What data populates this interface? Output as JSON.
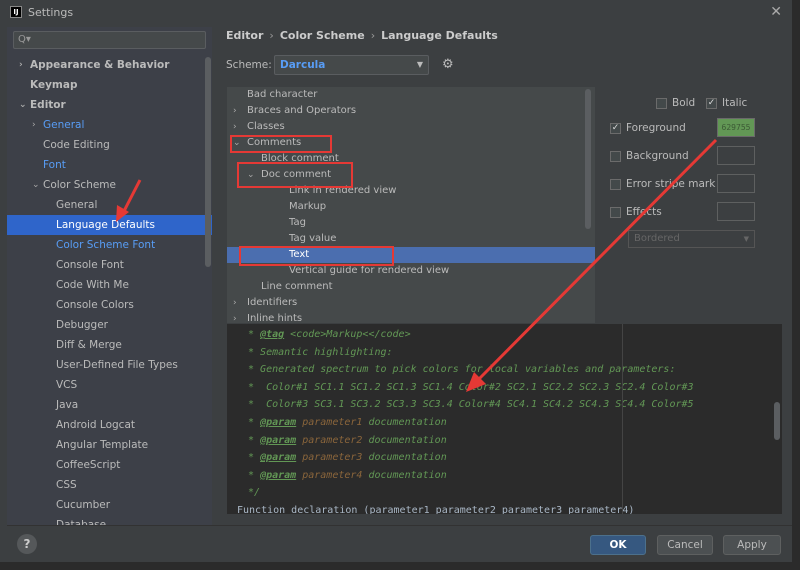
{
  "window": {
    "title": "Settings",
    "logo": "IJ"
  },
  "search": {
    "placeholder": "Q▾"
  },
  "sidebar": {
    "items": [
      {
        "label": "Appearance & Behavior",
        "level": 0,
        "arrow": "›",
        "bold": true
      },
      {
        "label": "Keymap",
        "level": 0,
        "bold": true
      },
      {
        "label": "Editor",
        "level": 0,
        "arrow": "⌄",
        "bold": true
      },
      {
        "label": "General",
        "level": 1,
        "arrow": "›",
        "link": true
      },
      {
        "label": "Code Editing",
        "level": 1
      },
      {
        "label": "Font",
        "level": 1,
        "link": true
      },
      {
        "label": "Color Scheme",
        "level": 1,
        "arrow": "⌄"
      },
      {
        "label": "General",
        "level": 2
      },
      {
        "label": "Language Defaults",
        "level": 2,
        "selected": true
      },
      {
        "label": "Color Scheme Font",
        "level": 2,
        "link": true
      },
      {
        "label": "Console Font",
        "level": 2
      },
      {
        "label": "Code With Me",
        "level": 2
      },
      {
        "label": "Console Colors",
        "level": 2
      },
      {
        "label": "Debugger",
        "level": 2
      },
      {
        "label": "Diff & Merge",
        "level": 2
      },
      {
        "label": "User-Defined File Types",
        "level": 2
      },
      {
        "label": "VCS",
        "level": 2
      },
      {
        "label": "Java",
        "level": 2
      },
      {
        "label": "Android Logcat",
        "level": 2
      },
      {
        "label": "Angular Template",
        "level": 2
      },
      {
        "label": "CoffeeScript",
        "level": 2
      },
      {
        "label": "CSS",
        "level": 2
      },
      {
        "label": "Cucumber",
        "level": 2
      },
      {
        "label": "Database",
        "level": 2
      }
    ]
  },
  "breadcrumb": [
    "Editor",
    "Color Scheme",
    "Language Defaults"
  ],
  "scheme": {
    "label": "Scheme:",
    "value": "Darcula"
  },
  "attributes": [
    {
      "label": "Bad character",
      "level": 0
    },
    {
      "label": "Braces and Operators",
      "level": 0,
      "arrow": "›"
    },
    {
      "label": "Classes",
      "level": 0,
      "arrow": "›"
    },
    {
      "label": "Comments",
      "level": 0,
      "arrow": "⌄"
    },
    {
      "label": "Block comment",
      "level": 1
    },
    {
      "label": "Doc comment",
      "level": 1,
      "arrow": "⌄"
    },
    {
      "label": "Link in rendered view",
      "level": 2
    },
    {
      "label": "Markup",
      "level": 2
    },
    {
      "label": "Tag",
      "level": 2
    },
    {
      "label": "Tag value",
      "level": 2
    },
    {
      "label": "Text",
      "level": 2,
      "selected": true
    },
    {
      "label": "Vertical guide for rendered view",
      "level": 2
    },
    {
      "label": "Line comment",
      "level": 1
    },
    {
      "label": "Identifiers",
      "level": 0,
      "arrow": "›"
    },
    {
      "label": "Inline hints",
      "level": 0,
      "arrow": "›"
    }
  ],
  "options": {
    "bold": {
      "label": "Bold",
      "checked": false
    },
    "italic": {
      "label": "Italic",
      "checked": true
    },
    "foreground": {
      "label": "Foreground",
      "checked": true,
      "color": "629755"
    },
    "background": {
      "label": "Background",
      "checked": false
    },
    "error_stripe": {
      "label": "Error stripe mark",
      "checked": false
    },
    "effects": {
      "label": "Effects",
      "checked": false,
      "type": "Bordered"
    }
  },
  "preview": {
    "lines": [
      [
        {
          "t": " * "
        },
        {
          "t": "@tag",
          "c": "tag"
        },
        {
          "t": " <code>Markup<</code>"
        }
      ],
      [
        {
          "t": " * Semantic highlighting:"
        }
      ],
      [
        {
          "t": " * Generated spectrum to pick colors for local variables and parameters:"
        }
      ],
      [
        {
          "t": " *  Color#1 SC1.1 SC1.2 SC1.3 SC1.4 Color#2 SC2.1 SC2.2 SC2.3 SC2.4 Color#3"
        }
      ],
      [
        {
          "t": " *  Color#3 SC3.1 SC3.2 SC3.3 SC3.4 Color#4 SC4.1 SC4.2 SC4.3 SC4.4 Color#5"
        }
      ],
      [
        {
          "t": " * "
        },
        {
          "t": "@param",
          "c": "tag"
        },
        {
          "t": " "
        },
        {
          "t": "parameter1",
          "c": "pn"
        },
        {
          "t": " documentation"
        }
      ],
      [
        {
          "t": " * "
        },
        {
          "t": "@param",
          "c": "tag"
        },
        {
          "t": " "
        },
        {
          "t": "parameter2",
          "c": "pn"
        },
        {
          "t": " documentation"
        }
      ],
      [
        {
          "t": " * "
        },
        {
          "t": "@param",
          "c": "tag"
        },
        {
          "t": " "
        },
        {
          "t": "parameter3",
          "c": "pn"
        },
        {
          "t": " documentation"
        }
      ],
      [
        {
          "t": " * "
        },
        {
          "t": "@param",
          "c": "tag"
        },
        {
          "t": " "
        },
        {
          "t": "parameter4",
          "c": "pn"
        },
        {
          "t": " documentation"
        }
      ],
      [
        {
          "t": " */"
        }
      ],
      [
        {
          "t": "Function declaration (parameter1 parameter2 parameter3 parameter4)",
          "c": "fn"
        }
      ]
    ]
  },
  "buttons": {
    "help": "?",
    "ok": "OK",
    "cancel": "Cancel",
    "apply": "Apply"
  },
  "colors": {
    "accent": "#2f65ca",
    "annotation": "#e53935",
    "comment": "#629755"
  }
}
